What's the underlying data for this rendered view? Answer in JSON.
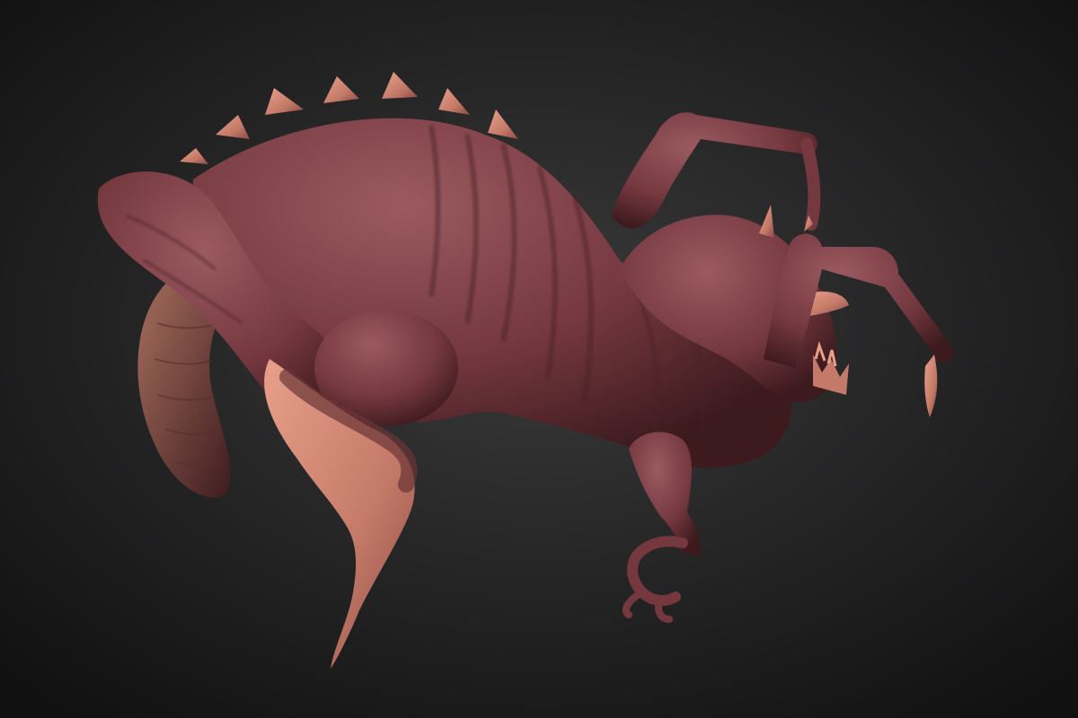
{
  "scene": {
    "subject": "creature-sculpt",
    "colors": {
      "background_center": "#3a3a3b",
      "background_edge": "#111112",
      "flesh_light": "#9a5a60",
      "flesh_mid": "#74383e",
      "flesh_dark": "#3c1a1e",
      "horn_light": "#e8a08a",
      "horn_mid": "#c47a68",
      "horn_dark": "#8a4a44",
      "belly_plate": "#a8705e"
    }
  }
}
